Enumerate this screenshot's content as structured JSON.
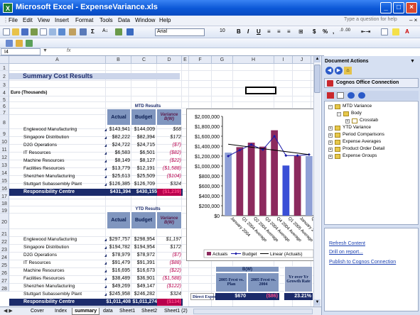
{
  "window": {
    "title": "Microsoft Excel - ExpenseVariance.xls",
    "app_icon": "excel-icon"
  },
  "menu": {
    "items": [
      "File",
      "Edit",
      "View",
      "Insert",
      "Format",
      "Tools",
      "Data",
      "Window",
      "Help"
    ],
    "help_search_placeholder": "Type a question for help"
  },
  "toolbar": {
    "font": "Arial",
    "size": "10",
    "bold": "B",
    "italic": "I",
    "underline": "U",
    "currency": "$",
    "percent": "%",
    "comma": ","
  },
  "formula": {
    "namebox": "I4",
    "fx": "fx",
    "value": ""
  },
  "columns": [
    "A",
    "B",
    "C",
    "D",
    "E",
    "F",
    "G",
    "H",
    "I",
    "J",
    "K"
  ],
  "rows": [
    "1",
    "2",
    "3",
    "4",
    "5",
    "6",
    "7",
    "8",
    "9",
    "10",
    "11",
    "12",
    "13",
    "14",
    "15",
    "16",
    "17",
    "18",
    "19",
    "20",
    "21",
    "22",
    "23",
    "24",
    "25",
    "26",
    "27",
    "28"
  ],
  "sheet": {
    "title": "Summary Cost Results",
    "subtitle": "Euro (Thousands)",
    "mtd_label": "MTD Results",
    "ytd_label": "YTD Results",
    "headers": {
      "actual": "Actual",
      "budget": "Budget",
      "variance": "Variance B(W)"
    },
    "mtd_rows": [
      {
        "name": "Englewood Manufacturing",
        "actual": "$143,941",
        "budget": "$144,009",
        "variance": "$68",
        "neg": false
      },
      {
        "name": "Singapore Distribution",
        "actual": "$82,222",
        "budget": "$82,394",
        "variance": "$172",
        "neg": false
      },
      {
        "name": "D2G Operations",
        "actual": "$24,722",
        "budget": "$24,715",
        "variance": "($7)",
        "neg": true
      },
      {
        "name": "IT Resources",
        "actual": "$6,583",
        "budget": "$6,501",
        "variance": "($82)",
        "neg": true
      },
      {
        "name": "Machine Resources",
        "actual": "$8,149",
        "budget": "$8,127",
        "variance": "($22)",
        "neg": true
      },
      {
        "name": "Facilities Resources",
        "actual": "$13,779",
        "budget": "$12,191",
        "variance": "($1,588)",
        "neg": true
      },
      {
        "name": "Shenzhen Manufacturing",
        "actual": "$25,613",
        "budget": "$25,509",
        "variance": "($104)",
        "neg": true
      },
      {
        "name": "Stuttgart Subassembly Plant",
        "actual": "$126,385",
        "budget": "$126,709",
        "variance": "$324",
        "neg": false
      }
    ],
    "mtd_total": {
      "name": "Responsibility Centre",
      "actual": "$431,394",
      "budget": "$430,155",
      "variance": "($1,239)"
    },
    "ytd_rows": [
      {
        "name": "Englewood Manufacturing",
        "actual": "$297,757",
        "budget": "$298,954",
        "variance": "$1,197",
        "neg": false
      },
      {
        "name": "Singapore Distribution",
        "actual": "$194,782",
        "budget": "$194,954",
        "variance": "$172",
        "neg": false
      },
      {
        "name": "D2G Operations",
        "actual": "$78,979",
        "budget": "$78,972",
        "variance": "($7)",
        "neg": true
      },
      {
        "name": "IT Resources",
        "actual": "$91,479",
        "budget": "$91,391",
        "variance": "($88)",
        "neg": true
      },
      {
        "name": "Machine Resources",
        "actual": "$16,695",
        "budget": "$16,673",
        "variance": "($22)",
        "neg": true
      },
      {
        "name": "Facilities Resources",
        "actual": "$38,489",
        "budget": "$36,901",
        "variance": "($1,588)",
        "neg": true
      },
      {
        "name": "Shenzhen Manufacturing",
        "actual": "$49,269",
        "budget": "$49,147",
        "variance": "($122)",
        "neg": true
      },
      {
        "name": "Stuttgart Subassembly Plant",
        "actual": "$245,958",
        "budget": "$246,282",
        "variance": "$324",
        "neg": false
      }
    ],
    "ytd_total": {
      "name": "Responsibility Centre",
      "actual": "$1,011,408",
      "budget": "$1,011,274",
      "variance": "($134)"
    },
    "bw_header": "B(W)",
    "forecast_plan": "2005 Frcst vs. Plan",
    "forecast_2004": "2005 Frcst vs. 2004",
    "growth": "Yr over Yr Growth Rate",
    "direct_expenses": "Direct Expenses",
    "de_plan": "$670",
    "de_2004": "($86)",
    "de_growth": "23.21%"
  },
  "chart_data": {
    "type": "bar",
    "categories": [
      "January 2004",
      "Q1 2004 Average",
      "Q2 2004 Average",
      "Q3 2004 Average",
      "Q4 2004 Average",
      "Q1 2005 Average",
      "January 2005",
      "Q1 2005 Forecast Avg"
    ],
    "ytick_labels": [
      "$2,000,000",
      "$1,800,000",
      "$1,600,000",
      "$1,400,000",
      "$1,200,000",
      "$1,000,000",
      "$800,000",
      "$600,000",
      "$400,000",
      "$200,000",
      "$0"
    ],
    "ylim": [
      0,
      2000000
    ],
    "series": [
      {
        "name": "Actuals",
        "values": [
          1270000,
          1380000,
          1470000,
          1390000,
          1720000,
          1010000,
          1200000,
          1200000
        ]
      },
      {
        "name": "Budget",
        "values": [
          1200000,
          1320000,
          1430000,
          1330000,
          1600000,
          1210000,
          1210000,
          1230000
        ]
      },
      {
        "name": "Linear (Actuals)",
        "values": [
          1440000,
          1410000,
          1380000,
          1350000,
          1320000,
          1290000,
          1260000,
          1230000
        ]
      }
    ],
    "legend_position": "bottom",
    "colors": {
      "actuals": "#8c2a5e",
      "actuals_alt": "#8fa0d6",
      "actuals_low": "#3a4fd6",
      "budget": "#1a1aa8",
      "trend": "#000000"
    }
  },
  "taskpane": {
    "title": "Document Actions",
    "cognos_title": "Cognos Office Connection",
    "tree": [
      {
        "label": "MTD Variance",
        "level": 0,
        "expanded": true
      },
      {
        "label": "Body",
        "level": 1,
        "expanded": true
      },
      {
        "label": "Crosstab",
        "level": 2,
        "expanded": false
      },
      {
        "label": "YTD Variance",
        "level": 0,
        "expanded": false
      },
      {
        "label": "Period Comparisons",
        "level": 0,
        "expanded": false
      },
      {
        "label": "Expense Averages",
        "level": 0,
        "expanded": false
      },
      {
        "label": "Product Order Detail",
        "level": 0,
        "expanded": false
      },
      {
        "label": "Expense Groups",
        "level": 0,
        "expanded": false
      }
    ],
    "links": [
      "Refresh Content",
      "Drill on report...",
      "Publish to Cognos Connection"
    ]
  },
  "tabs": {
    "nav": "◀ ▶",
    "items": [
      "Cover",
      "Index",
      "summary",
      "data",
      "Sheet1",
      "Sheet2",
      "Sheet1 (2)"
    ],
    "active": "summary"
  },
  "colors": {
    "header_fill": "#8096bf",
    "total_band": "#1b2b6b",
    "negative": "#b8004d",
    "title_bar": "#0b57d6"
  }
}
